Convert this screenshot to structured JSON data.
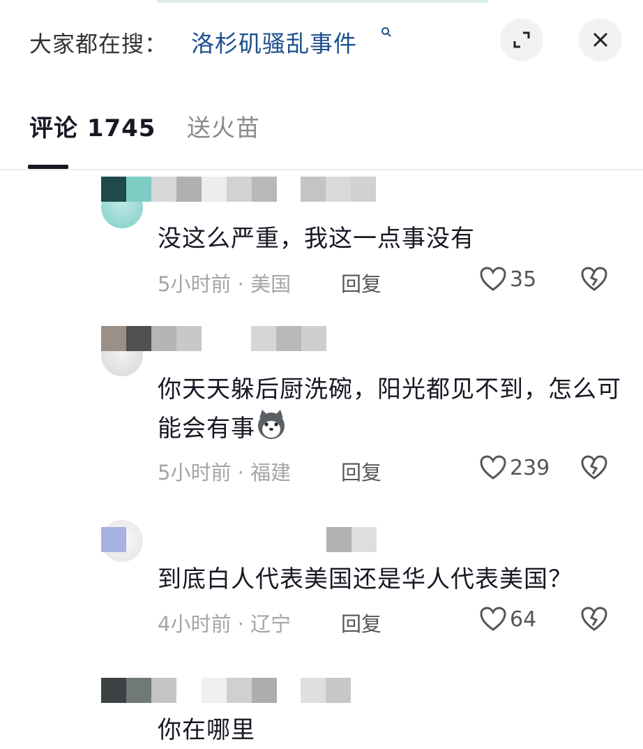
{
  "header": {
    "search_prefix": "大家都在搜：",
    "search_term": "洛杉矶骚乱事件",
    "search_icon": "search-icon",
    "expand_icon": "expand-icon",
    "close_icon": "close-icon"
  },
  "tabs": [
    {
      "label": "评论 1745",
      "active": true
    },
    {
      "label": "送火苗",
      "active": false
    }
  ],
  "comments": [
    {
      "text": "没这么严重，我这一点事没有",
      "time_loc": "5小时前 · 美国",
      "reply": "回复",
      "likes": "35"
    },
    {
      "text": "你天天躲后厨洗碗，阳光都见不到，怎么可能会有事",
      "emoji": "husky-emoji",
      "time_loc": "5小时前 · 福建",
      "reply": "回复",
      "likes": "239"
    },
    {
      "text": "到底白人代表美国还是华人代表美国？",
      "time_loc": "4小时前 · 辽宁",
      "reply": "回复",
      "likes": "64"
    },
    {
      "text": "你在哪里"
    }
  ],
  "colors": {
    "search_term": "#1d4f8f",
    "meta": "#a5a5a5",
    "text": "#161823"
  }
}
